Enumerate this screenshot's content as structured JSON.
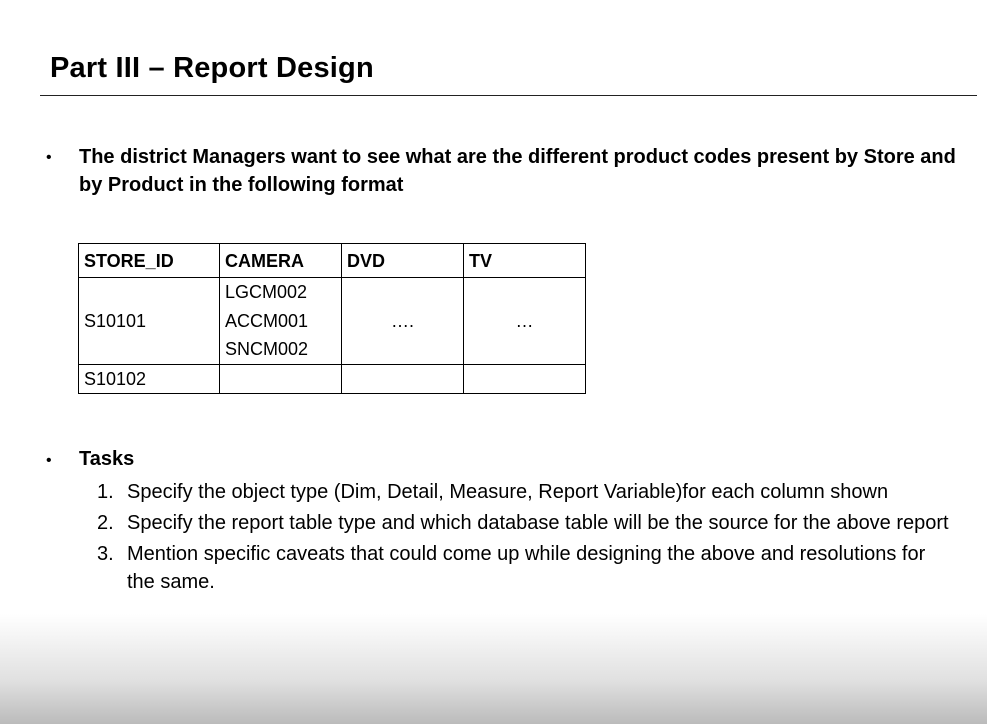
{
  "slide": {
    "title": "Part III – Report Design",
    "bullet_symbol": "•",
    "intro": "The district Managers want to see what are the different product codes present by Store and by Product in the following format"
  },
  "table": {
    "headers": [
      "STORE_ID",
      "CAMERA",
      "DVD",
      "TV"
    ],
    "rows": [
      {
        "store_id": "S10101",
        "camera": [
          "LGCM002",
          "ACCM001",
          "SNCM002"
        ],
        "dvd": "….",
        "tv": "…"
      },
      {
        "store_id": "S10102",
        "camera": [],
        "dvd": "",
        "tv": ""
      }
    ]
  },
  "tasks": {
    "heading": "Tasks",
    "items": [
      {
        "number": "1.",
        "text": "Specify the object type (Dim, Detail, Measure, Report Variable)for each column shown"
      },
      {
        "number": "2.",
        "text": "Specify the report table type and which database table will be the source for the above report"
      },
      {
        "number": "3.",
        "text": "Mention specific caveats that could come up while designing the above and resolutions for the same."
      }
    ]
  }
}
